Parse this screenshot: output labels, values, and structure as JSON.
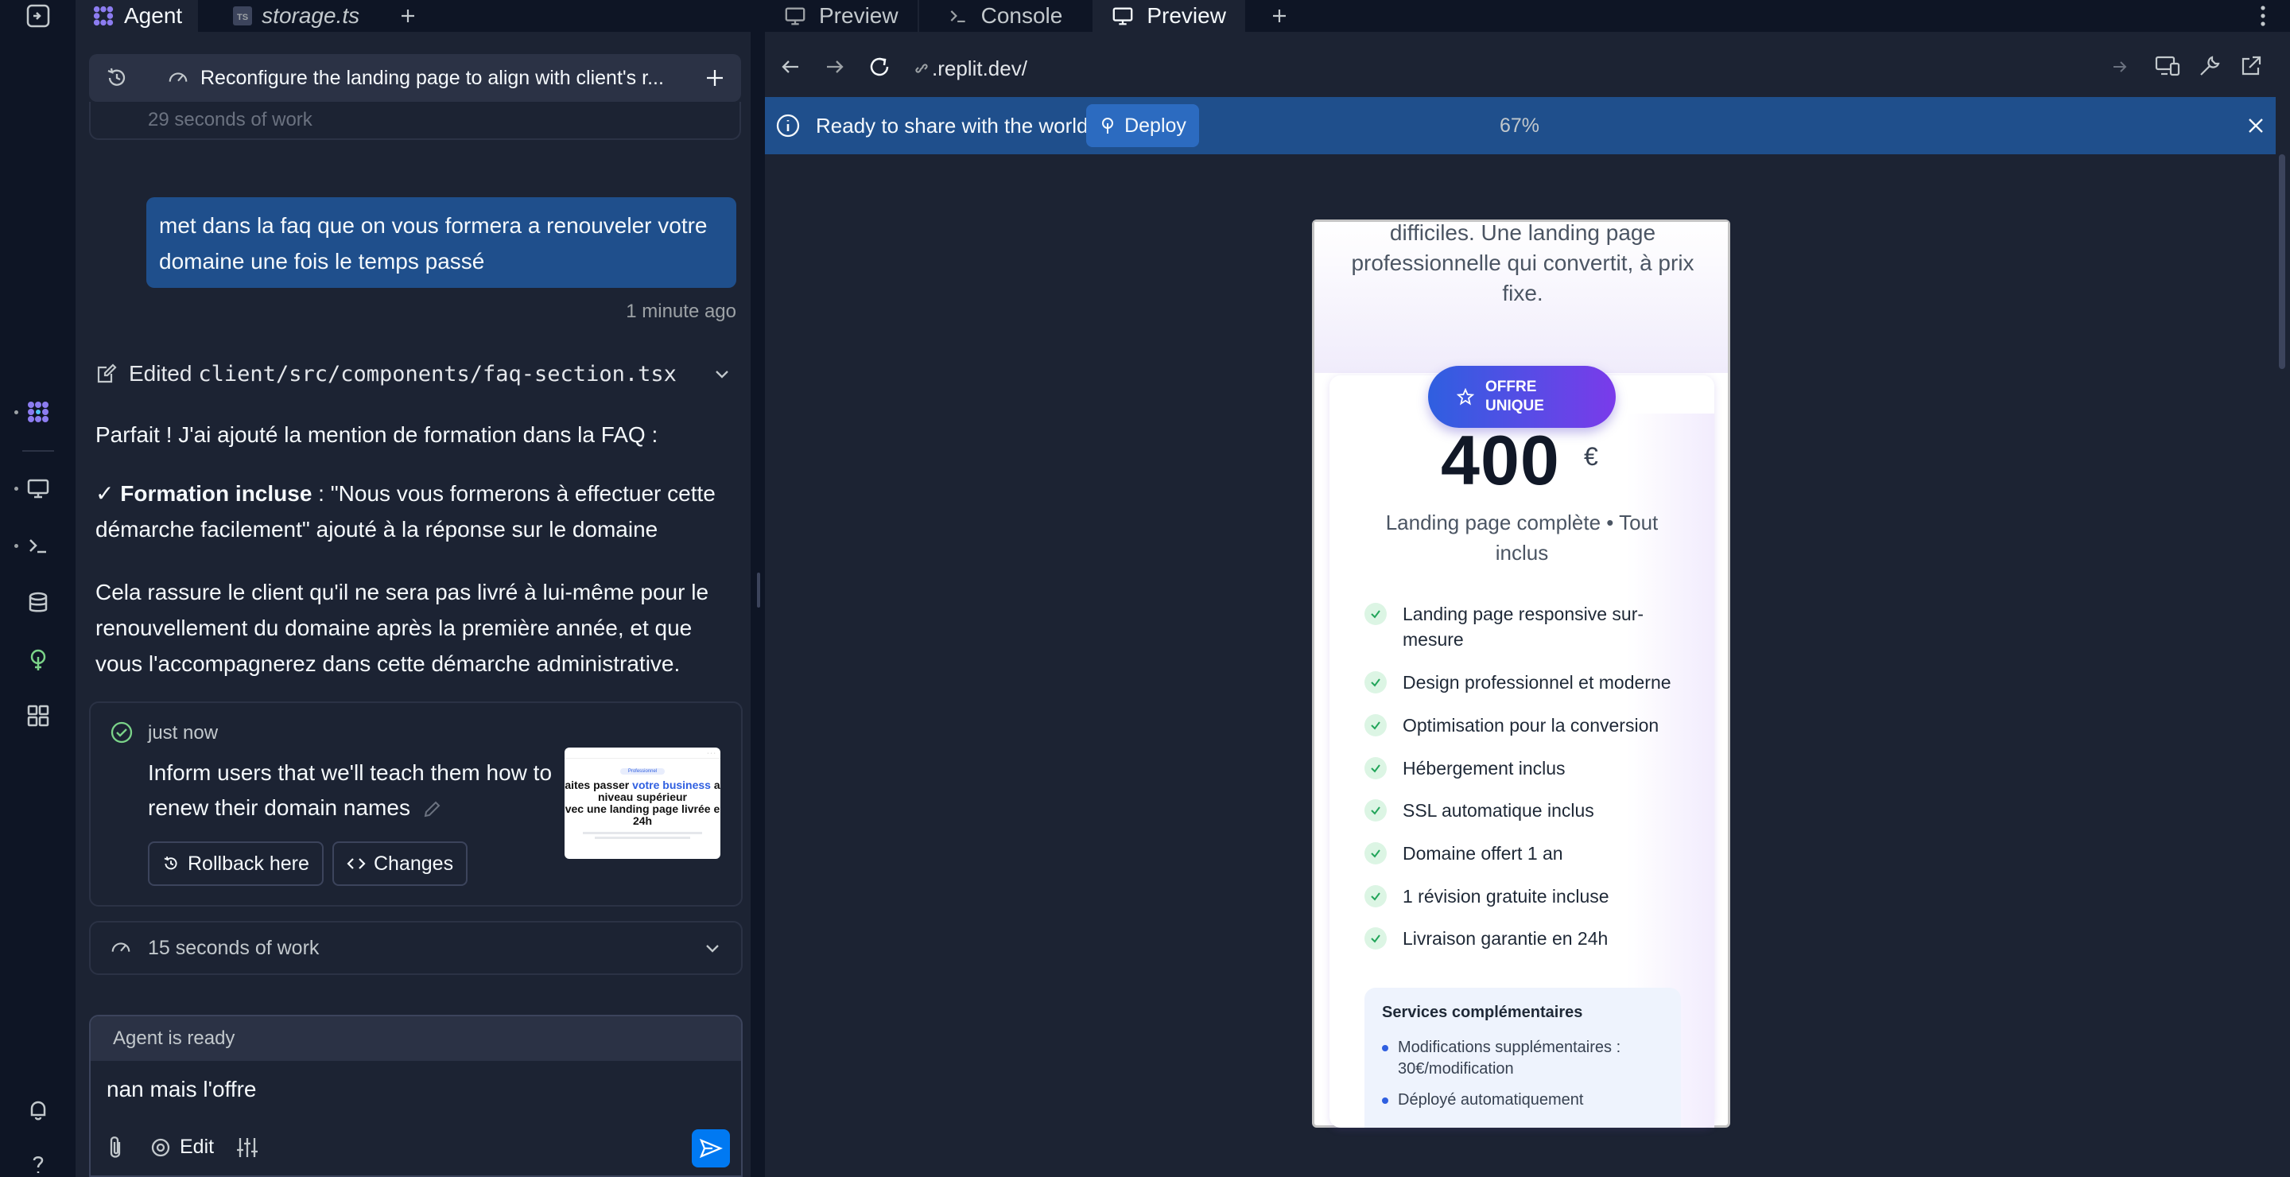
{
  "left_tabs": [
    {
      "label": "Agent",
      "icon": "agent-icon",
      "active": true
    },
    {
      "label": "storage.ts",
      "icon": "typescript-file-icon",
      "active": false
    }
  ],
  "context_bar": {
    "title": "Reconfigure the landing page to align with client's r..."
  },
  "previous_work": "29 seconds of work",
  "user_message": {
    "text": "met dans la faq que on vous formera a renouveler votre domaine une fois le temps passé",
    "timestamp": "1 minute ago"
  },
  "edited": {
    "label": "Edited",
    "path": "client/src/components/faq-section.tsx"
  },
  "agent_reply": {
    "intro": "Parfait ! J'ai ajouté la mention de formation dans la FAQ :",
    "check_mark": "✓",
    "bold": "Formation incluse",
    "after_bold": " : \"Nous vous formerons à effectuer cette démarche facilement\" ajouté à la réponse sur le domaine",
    "closing": "Cela rassure le client qu'il ne sera pas livré à lui-même pour le renouvellement du domaine après la première année, et que vous l'accompagnerez dans cette démarche administrative."
  },
  "checkpoint": {
    "time": "just now",
    "text": "Inform users that we'll teach them how to renew their domain names",
    "rollback_label": "Rollback here",
    "changes_label": "Changes",
    "thumbnail": {
      "pill": "Professionnel",
      "line1_pre": "aites passer ",
      "line1_hl": "votre business",
      "line1_post": " a",
      "line2": "niveau supérieur",
      "line3": "vec une landing page livrée e",
      "line4": "24h"
    }
  },
  "work2": "15 seconds of work",
  "composer": {
    "status": "Agent is ready",
    "text": "nan mais l'offre",
    "edit_label": "Edit"
  },
  "right_tabs": [
    {
      "label": "Preview",
      "icon": "monitor-icon",
      "active": false
    },
    {
      "label": "Console",
      "icon": "terminal-icon",
      "active": false
    },
    {
      "label": "Preview",
      "icon": "monitor-icon",
      "active": true
    }
  ],
  "url": ".replit.dev/",
  "banner": {
    "text": "Ready to share with the world?",
    "deploy_label": "Deploy",
    "zoom": "67%"
  },
  "preview": {
    "lead": "difficiles. Une landing page professionnelle qui convertit, à prix fixe.",
    "badge": "OFFRE UNIQUE",
    "price": "400",
    "currency": "€",
    "price_sub": "Landing page complète • Tout inclus",
    "features": [
      "Landing page responsive sur-mesure",
      "Design professionnel et moderne",
      "Optimisation pour la conversion",
      "Hébergement inclus",
      "SSL automatique inclus",
      "Domaine offert 1 an",
      "1 révision gratuite incluse",
      "Livraison garantie en 24h"
    ],
    "services_title": "Services complémentaires",
    "services": [
      "Modifications supplémentaires : 30€/modification",
      "Déployé automatiquement"
    ]
  },
  "colors": {
    "accent": "#0079f2",
    "banner": "#1f4f8c",
    "user_bubble": "#1f4f8c",
    "panel": "#1c2333",
    "bg": "#0e1525"
  }
}
